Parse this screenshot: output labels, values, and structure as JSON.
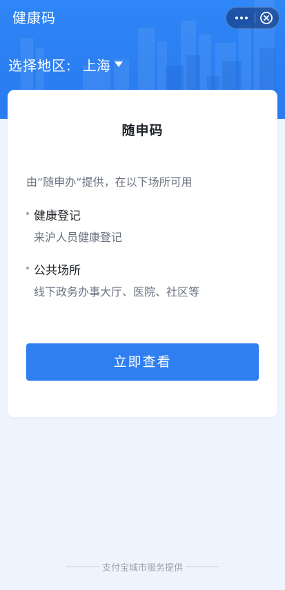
{
  "header": {
    "app_title": "健康码",
    "region_label": "选择地区:",
    "region_value": "上海"
  },
  "card": {
    "title": "随申码",
    "provider_text": "由“随申办“提供，在以下场所可用",
    "venues": [
      {
        "name": "健康登记",
        "desc": "来沪人员健康登记"
      },
      {
        "name": "公共场所",
        "desc": "线下政务办事大厅、医院、社区等"
      }
    ],
    "button_label": "立即查看"
  },
  "footer": {
    "text": "支付宝城市服务提供"
  },
  "icons": {
    "more": "more-dots-icon",
    "close": "close-circle-icon",
    "caret": "caret-down-icon"
  },
  "colors": {
    "header_blue": "#2b7ff2",
    "button_blue": "#2f7ff1",
    "page_background": "#eef4fd",
    "card_background": "#ffffff"
  }
}
